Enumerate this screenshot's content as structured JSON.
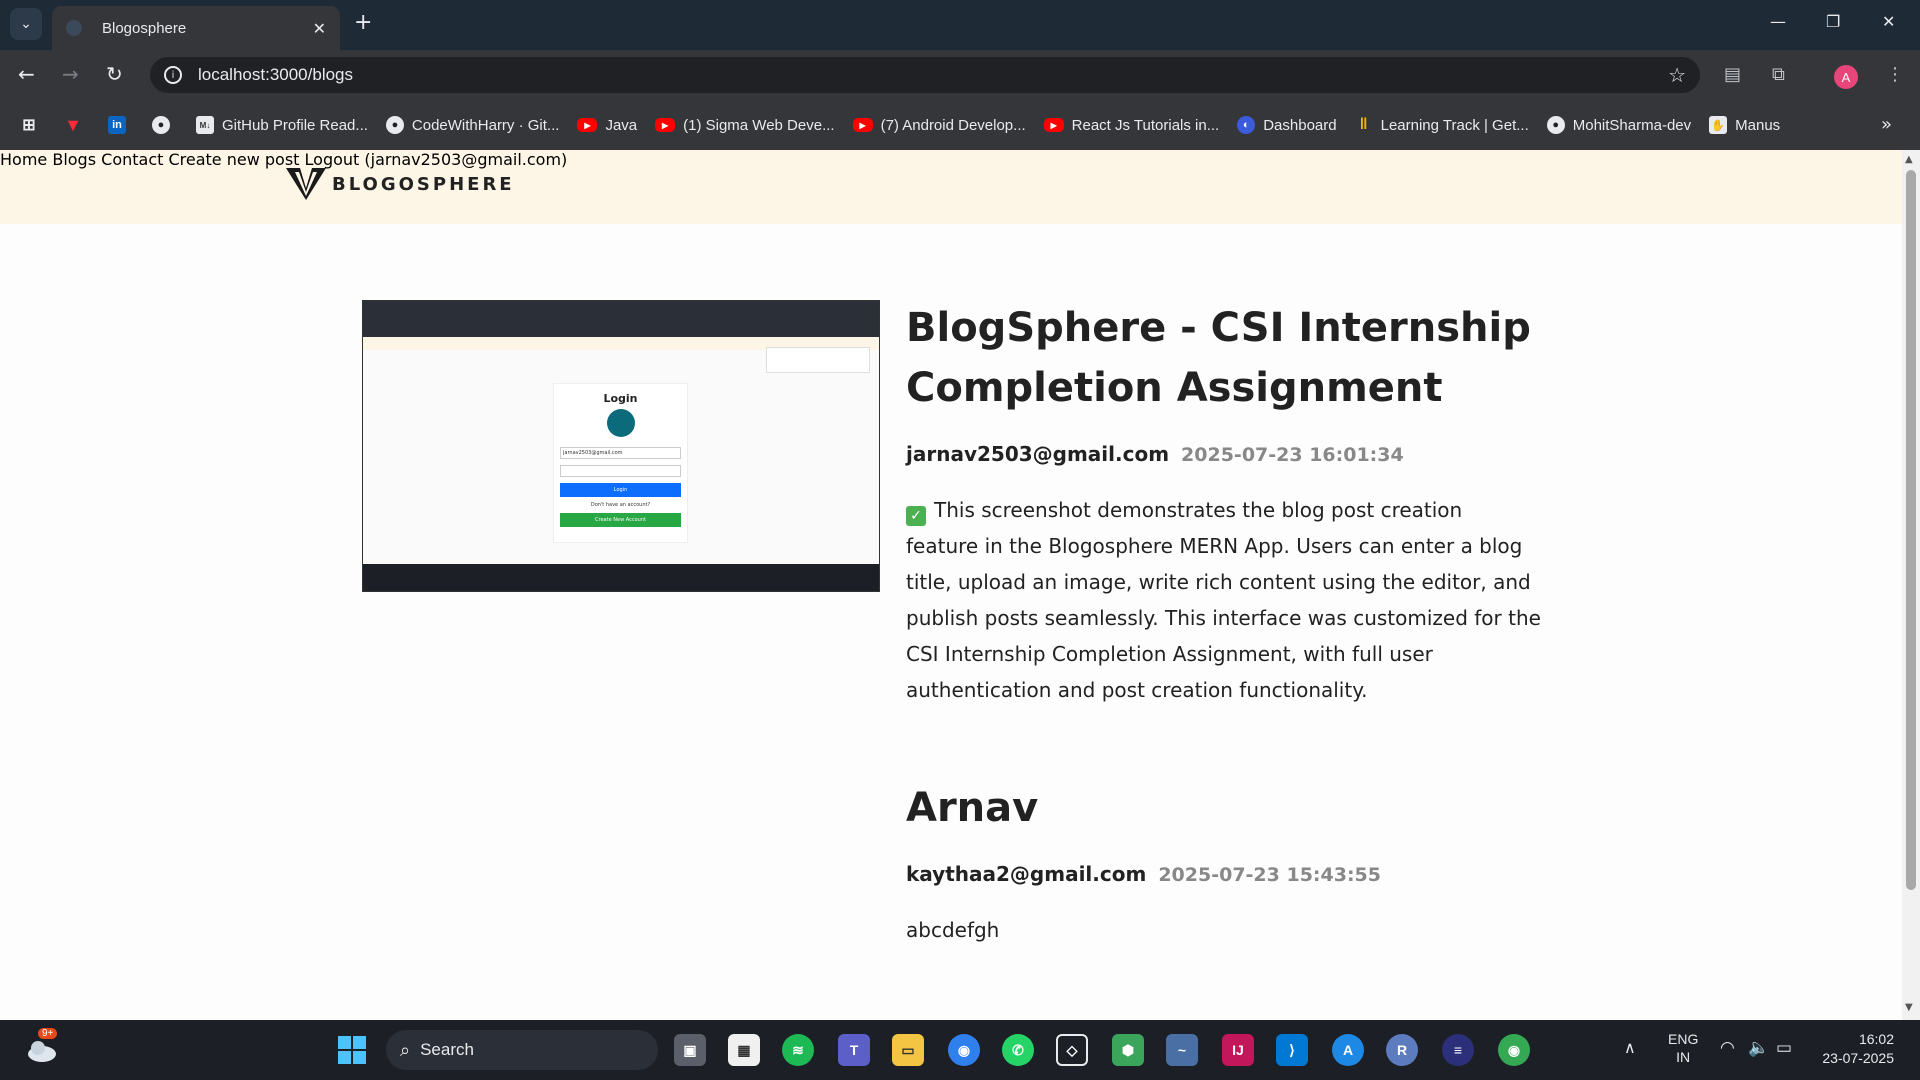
{
  "browser": {
    "tab_title": "Blogosphere",
    "url": "localhost:3000/blogs",
    "profile_initial": "A",
    "bookmarks": [
      {
        "label": "",
        "icon": "apps-grid-icon"
      },
      {
        "label": "",
        "icon": "vivaldi-icon"
      },
      {
        "label": "",
        "icon": "linkedin-icon"
      },
      {
        "label": "",
        "icon": "github-icon"
      },
      {
        "label": "GitHub Profile Read...",
        "icon": "readme-icon"
      },
      {
        "label": "CodeWithHarry · Git...",
        "icon": "github-icon"
      },
      {
        "label": "Java",
        "icon": "youtube-icon"
      },
      {
        "label": "(1) Sigma Web Deve...",
        "icon": "youtube-icon"
      },
      {
        "label": "(7) Android Develop...",
        "icon": "youtube-icon"
      },
      {
        "label": "React Js Tutorials in...",
        "icon": "youtube-icon"
      },
      {
        "label": "Dashboard",
        "icon": "dashboard-icon"
      },
      {
        "label": "Learning Track | Get...",
        "icon": "chart-icon"
      },
      {
        "label": "MohitSharma-dev",
        "icon": "github-icon"
      },
      {
        "label": "Manus",
        "icon": "manus-icon"
      }
    ]
  },
  "site": {
    "logo_text": "BLOGOSPHERE",
    "nav": {
      "home": "Home",
      "blogs": "Blogs",
      "contact": "Contact",
      "create": "Create new post",
      "logout": "Logout (jarnav2503@gmail.com)"
    }
  },
  "posts": [
    {
      "title_line1": "BlogSphere - CSI Internship",
      "title_line2": "Completion Assignment",
      "author": "jarnav2503@gmail.com",
      "time": "2025-07-23 16:01:34",
      "content_lines": [
        "This screenshot demonstrates the blog post creation",
        "feature in the Blogosphere MERN App. Users can enter a blog",
        "title, upload an image, write rich content using the editor, and",
        "publish posts seamlessly. This interface was customized for the",
        "CSI Internship Completion Assignment, with full user",
        "authentication and post creation functionality."
      ],
      "check_emoji": "✅"
    },
    {
      "title": "Arnav",
      "author": "kaythaa2@gmail.com",
      "time": "2025-07-23 15:43:55",
      "content": "abcdefgh"
    }
  ],
  "thumb": {
    "login_title": "Login",
    "email_value": "jarnav2503@gmail.com",
    "login_button": "Login",
    "no_account": "Don't have an account?",
    "create_account": "Create New Account"
  },
  "taskbar": {
    "notification_badge": "9+",
    "search_label": "Search",
    "lang_line1": "ENG",
    "lang_line2": "IN",
    "time": "16:02",
    "date": "23-07-2025"
  }
}
